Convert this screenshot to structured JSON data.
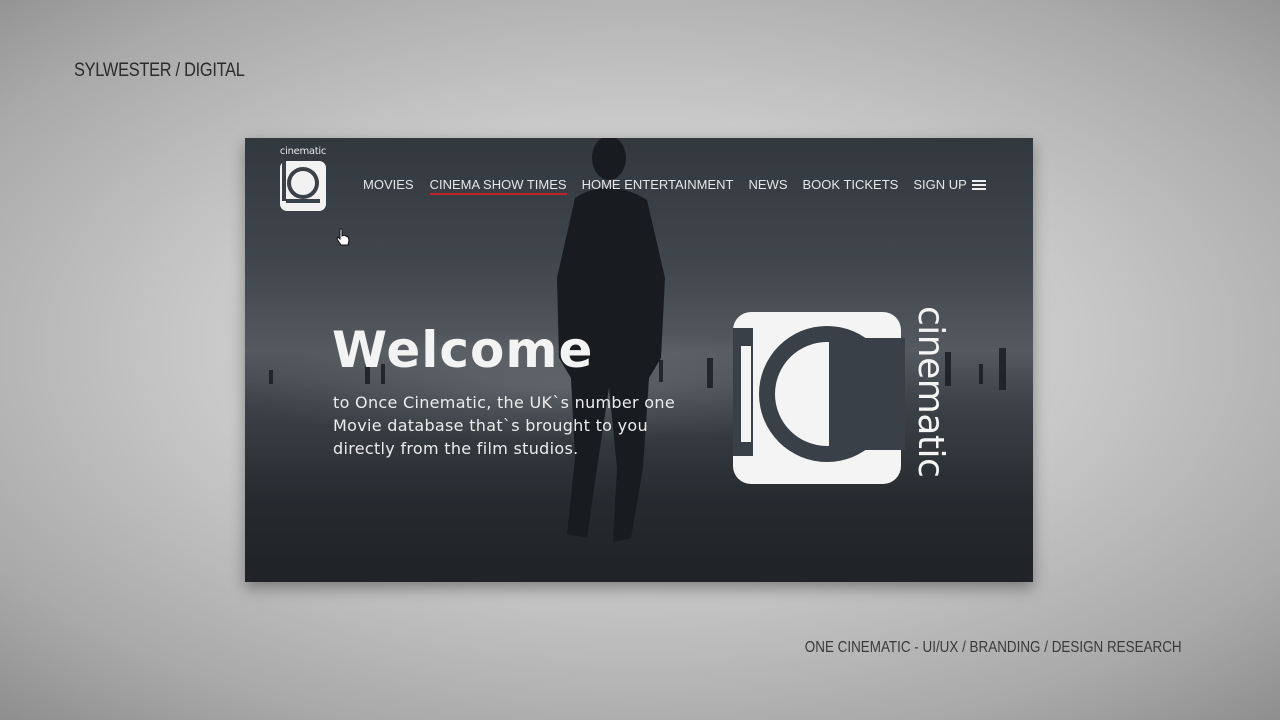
{
  "slide": {
    "corner_label": "SYLWESTER / DIGITAL",
    "footer_label": "ONE CINEMATIC - UI/UX /  BRANDING / DESIGN RESEARCH"
  },
  "site": {
    "brand_word": "cinematic",
    "nav": {
      "items": [
        {
          "label": "MOVIES",
          "active": false
        },
        {
          "label": "CINEMA SHOW TIMES",
          "active": true
        },
        {
          "label": "HOME ENTERTAINMENT",
          "active": false
        },
        {
          "label": "NEWS",
          "active": false
        },
        {
          "label": "BOOK TICKETS",
          "active": false
        },
        {
          "label": "SIGN UP",
          "active": false
        }
      ],
      "menu_icon": "hamburger-menu-icon",
      "active_underline_color": "#c0222a"
    },
    "hero": {
      "title": "Welcome",
      "lines": [
        "to Once Cinematic, the UK`s number one",
        "Movie database that`s brought to you",
        "directly from the film studios."
      ],
      "brand_word": "cinematic"
    },
    "pointer_icon": "hand-pointer-icon"
  }
}
